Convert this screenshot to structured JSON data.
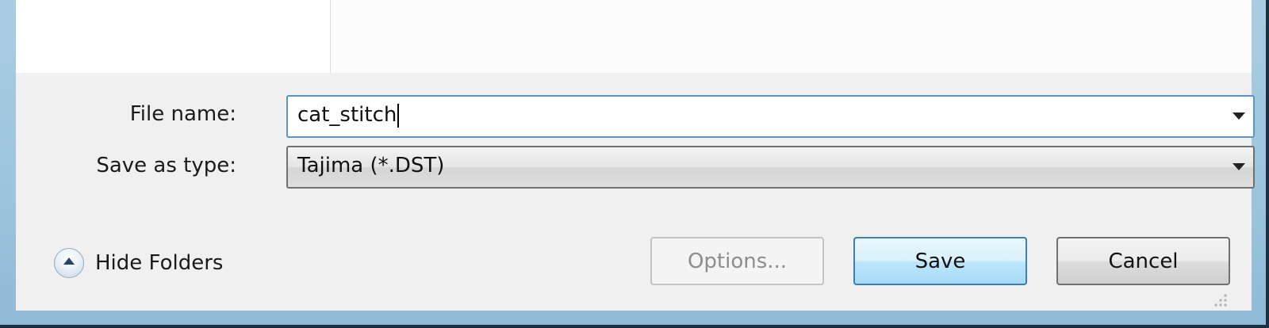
{
  "dialog": {
    "file_name": {
      "label": "File name:",
      "value": "cat_stitch"
    },
    "save_as_type": {
      "label": "Save as type:",
      "value": "Tajima (*.DST)"
    },
    "hide_folders_label": "Hide Folders",
    "buttons": {
      "options": "Options...",
      "save": "Save",
      "cancel": "Cancel"
    }
  },
  "icons": {
    "hide_folders": "chevron-up-circle-icon",
    "dropdown": "chevron-down-icon",
    "size_grip": "resize-grip-icon"
  },
  "colors": {
    "frame": "#9cc4de",
    "dialog_background": "#f0f0f0",
    "focused_border": "#5f93bd",
    "default_button_border": "#3c7fb1",
    "disabled_text": "#8d8d8d"
  }
}
